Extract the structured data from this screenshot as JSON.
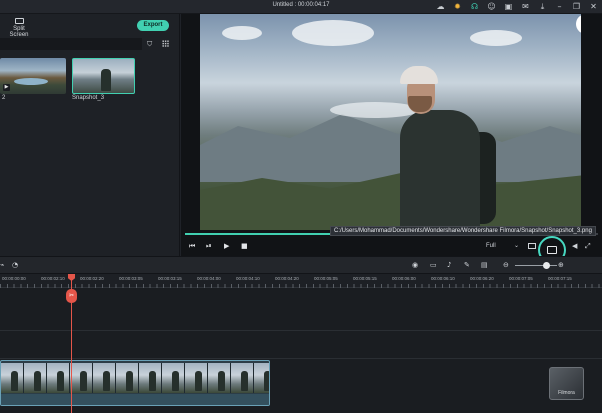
{
  "window": {
    "title": "Untitled : 00:00:04:17",
    "icons": [
      "cloud-icon",
      "bulb-icon",
      "headset-icon",
      "account-icon",
      "save-icon",
      "mail-icon",
      "download-icon",
      "minimize-icon",
      "restore-icon",
      "close-icon"
    ]
  },
  "media_panel": {
    "split_screen_label": "Split Screen",
    "export_label": "Export",
    "search_placeholder": "",
    "thumbnails": [
      {
        "label": "2",
        "selected": false
      },
      {
        "label": "Snapshot_3",
        "selected": true
      }
    ]
  },
  "preview": {
    "info_icon": "i",
    "saved_path_tooltip": "C:/Users/Mohammad/Documents/Wondershare/Wondershare Filmora/Snapshot/Snapshot_3.png",
    "quality_label": "Full",
    "progress": 0.36,
    "controls": {
      "prev_icon": "⏮",
      "step_icon": "⏯",
      "play_icon": "▶",
      "stop_icon": "■",
      "caret": "⌄",
      "volume_icon": "◀",
      "fullscreen_icon": "⤢"
    }
  },
  "timeline_toolbar": {
    "left_icons": [
      "⌁",
      "◔"
    ],
    "right_icons": [
      "◉",
      "▭",
      "♪",
      "✎",
      "▤",
      "⊖",
      "⊕"
    ]
  },
  "ruler": {
    "labels": [
      "00:00:00:00",
      "00:00:02:10",
      "00:00:02:20",
      "00:00:03:05",
      "00:00:03:15",
      "00:00:04:00",
      "00:00:04:10",
      "00:00:04:20",
      "00:00:05:05",
      "00:00:05:15",
      "00:00:06:00",
      "00:00:06:10",
      "00:00:06:20",
      "00:00:07:05",
      "00:00:07:15"
    ]
  },
  "playhead": {
    "marker": "✂"
  },
  "brand": {
    "logo_text": "Filmora",
    "accent": "#41d0b1",
    "playhead_color": "#e4564a"
  }
}
